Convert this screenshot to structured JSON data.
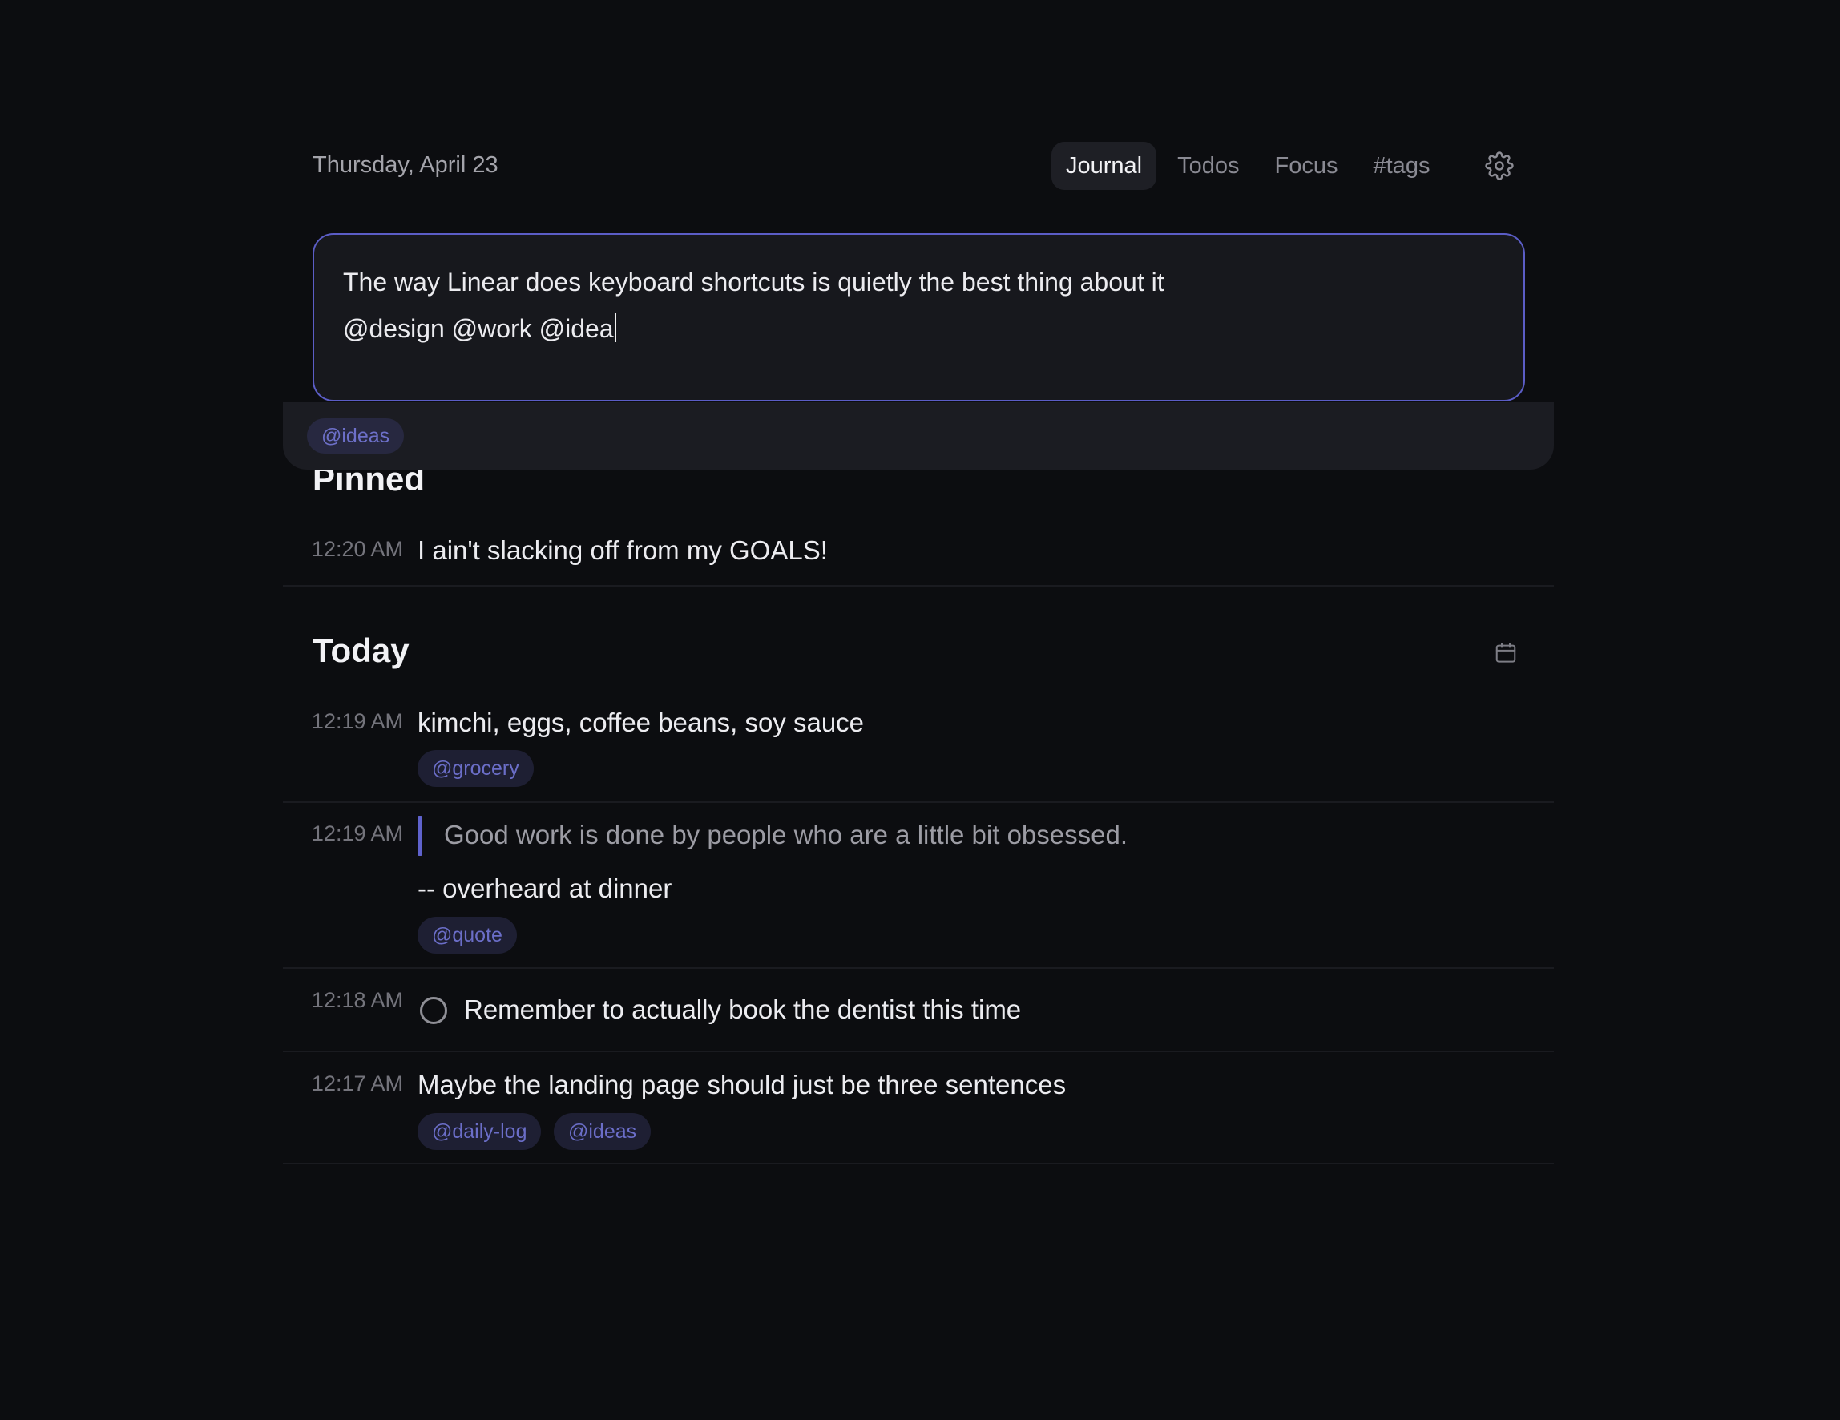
{
  "header": {
    "date": "Thursday, April 23",
    "tabs": [
      {
        "label": "Journal",
        "active": true
      },
      {
        "label": "Todos",
        "active": false
      },
      {
        "label": "Focus",
        "active": false
      },
      {
        "label": "#tags",
        "active": false
      }
    ],
    "settings_icon": "gear-icon"
  },
  "composer": {
    "line1": "The way Linear does keyboard shortcuts is quietly the best thing about it",
    "line2": "@design @work @idea",
    "border_color": "#5b5dc6"
  },
  "suggestion": {
    "chip": "@ideas"
  },
  "pinned": {
    "title": "Pinned",
    "entries": [
      {
        "time": "12:20 AM",
        "text": "I ain't slacking off from my GOALS!"
      }
    ]
  },
  "today": {
    "title": "Today",
    "calendar_icon": "calendar-icon",
    "entries": [
      {
        "time": "12:19 AM",
        "text": "kimchi, eggs, coffee beans, soy sauce",
        "tags": [
          "@grocery"
        ]
      },
      {
        "time": "12:19 AM",
        "quote": "Good work is done by people who are a little bit obsessed.",
        "text": "-- overheard at dinner",
        "tags": [
          "@quote"
        ]
      },
      {
        "time": "12:18 AM",
        "todo": true,
        "text": "Remember to actually book the dentist this time"
      },
      {
        "time": "12:17 AM",
        "text": "Maybe the landing page should just be three sentences",
        "tags": [
          "@daily-log",
          "@ideas"
        ]
      }
    ]
  },
  "colors": {
    "background": "#0c0d10",
    "accent": "#5f62cc",
    "tag_text": "#6b6ec8",
    "tag_bg": "#1e1f33"
  }
}
